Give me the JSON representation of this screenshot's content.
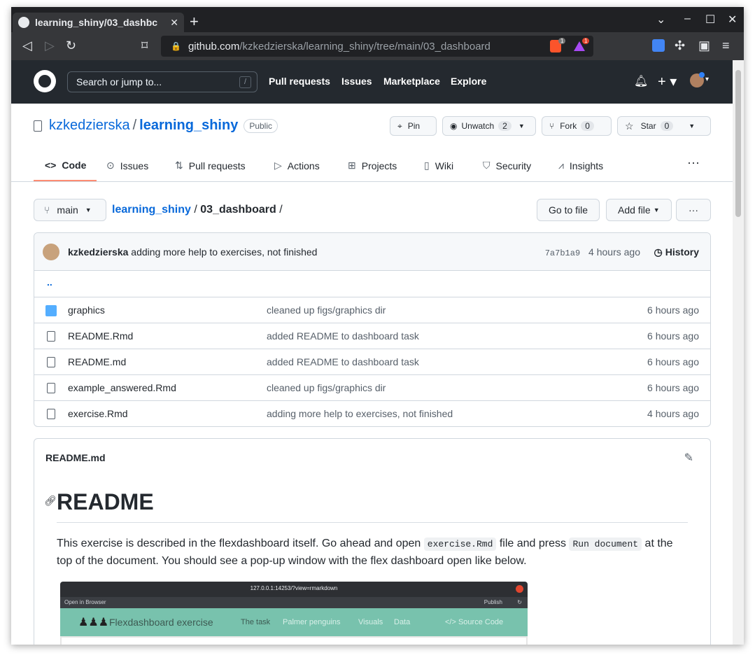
{
  "browser": {
    "tab_title": "learning_shiny/03_dashbc",
    "tab_close": "✕",
    "new_tab": "+",
    "url_host": "github.com",
    "url_path": "/kzkedzierska/learning_shiny/tree/main/03_dashboard",
    "brave_badge": "1",
    "alert_badge": "1"
  },
  "gh": {
    "search_placeholder": "Search or jump to...",
    "search_key": "/",
    "nav": [
      "Pull requests",
      "Issues",
      "Marketplace",
      "Explore"
    ]
  },
  "repo": {
    "owner": "kzkedzierska",
    "name": "learning_shiny",
    "visibility": "Public",
    "pin_label": "Pin",
    "watch_label": "Unwatch",
    "watch_count": "2",
    "fork_label": "Fork",
    "fork_count": "0",
    "star_label": "Star",
    "star_count": "0"
  },
  "tabs": [
    "Code",
    "Issues",
    "Pull requests",
    "Actions",
    "Projects",
    "Wiki",
    "Security",
    "Insights"
  ],
  "filenav": {
    "branch": "main",
    "crumb_repo": "learning_shiny",
    "crumb_dir": "03_dashboard",
    "crumb_trail": "/",
    "goto_file": "Go to file",
    "add_file": "Add file",
    "more": "···"
  },
  "commit": {
    "author": "kzkedzierska",
    "message": "adding more help to exercises, not finished",
    "sha": "7a7b1a9",
    "age": "4 hours ago",
    "history_label": "History"
  },
  "updir": "..",
  "files": [
    {
      "name": "graphics",
      "type": "folder",
      "message": "cleaned up figs/graphics dir",
      "age": "6 hours ago"
    },
    {
      "name": "README.Rmd",
      "type": "file",
      "message": "added README to dashboard task",
      "age": "6 hours ago"
    },
    {
      "name": "README.md",
      "type": "file",
      "message": "added README to dashboard task",
      "age": "6 hours ago"
    },
    {
      "name": "example_answered.Rmd",
      "type": "file",
      "message": "cleaned up figs/graphics dir",
      "age": "6 hours ago"
    },
    {
      "name": "exercise.Rmd",
      "type": "file",
      "message": "adding more help to exercises, not finished",
      "age": "4 hours ago"
    }
  ],
  "readme": {
    "filename": "README.md",
    "heading": "README",
    "p1": "This exercise is described in the flexdashboard itself. Go ahead and open",
    "code1": "exercise.Rmd",
    "p2": "file and press",
    "code2": "Run document",
    "p3": "at the top of the document. You should see a pop-up window with the flex dashboard open like below."
  },
  "screenshot": {
    "url": "127.0.0.1:14253/?view=rmarkdown",
    "open_in_browser": "Open in Browser",
    "publish": "Publish",
    "title": "Flexdashboard exercise",
    "nav": [
      "The task",
      "Palmer penguins",
      "Visuals",
      "Data"
    ],
    "source": "</> Source Code"
  }
}
